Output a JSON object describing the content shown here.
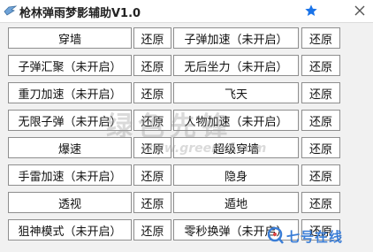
{
  "window": {
    "title": "枪林弹雨梦影辅助V1.0",
    "icons": {
      "app": "app-icon",
      "favorite": "star-icon",
      "close": "close-icon"
    },
    "colors": {
      "star": "#1a73e8",
      "button_border": "#8e8e8e",
      "background": "#f1f1f1"
    }
  },
  "rows": [
    {
      "left_label": "穿墙",
      "left_reset": "还原",
      "right_label": "子弹加速（未开启）",
      "right_reset": "还原"
    },
    {
      "left_label": "子弹汇聚（未开启）",
      "left_reset": "还原",
      "right_label": "无后坐力（未开启）",
      "right_reset": "还原"
    },
    {
      "left_label": "重刀加速（未开启）",
      "left_reset": "还原",
      "right_label": "飞天",
      "right_reset": "还原"
    },
    {
      "left_label": "无限子弹（未开启）",
      "left_reset": "还原",
      "right_label": "人物加速（未开启）",
      "right_reset": "还原"
    },
    {
      "left_label": "爆速",
      "left_reset": "还原",
      "right_label": "超级穿墙",
      "right_reset": "还原"
    },
    {
      "left_label": "手雷加速（未开启）",
      "left_reset": "还原",
      "right_label": "隐身",
      "right_reset": "还原"
    },
    {
      "left_label": "透视",
      "left_reset": "还原",
      "right_label": "遁地",
      "right_reset": "还原"
    },
    {
      "left_label": "狙神模式（未开启）",
      "left_reset": "还原",
      "right_label": "零秒换弹（未开启）",
      "right_reset": "还原"
    }
  ],
  "watermark": {
    "center_text": "绿色先锋",
    "url_text": "www.greenxf.com",
    "logo_text": "七号在线"
  }
}
